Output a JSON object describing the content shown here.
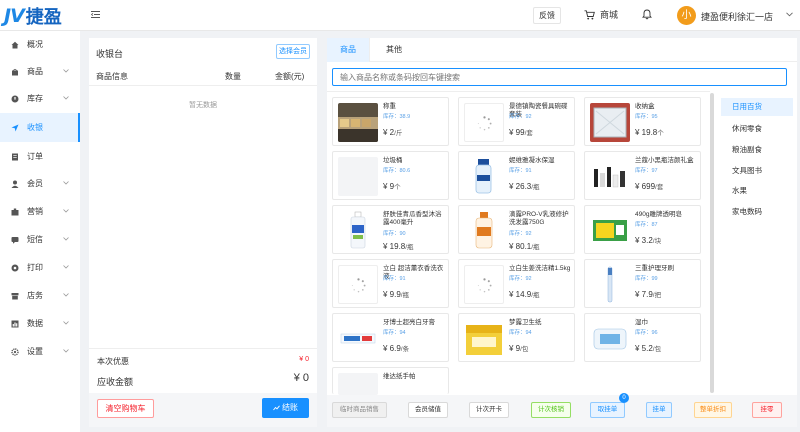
{
  "header": {
    "logo_mark": "JV",
    "logo_text": "捷盈",
    "feedback": "反馈",
    "mall": "商城",
    "avatar_char": "小",
    "store_name": "捷盈便利徐汇一店"
  },
  "sidebar": {
    "items": [
      {
        "label": "概况",
        "icon": "home-icon"
      },
      {
        "label": "商品",
        "icon": "goods-icon"
      },
      {
        "label": "库存",
        "icon": "stock-icon"
      },
      {
        "label": "收银",
        "icon": "cashier-icon"
      },
      {
        "label": "订单",
        "icon": "order-icon"
      },
      {
        "label": "会员",
        "icon": "member-icon"
      },
      {
        "label": "营销",
        "icon": "marketing-icon"
      },
      {
        "label": "短信",
        "icon": "sms-icon"
      },
      {
        "label": "打印",
        "icon": "print-icon"
      },
      {
        "label": "店务",
        "icon": "store-icon"
      },
      {
        "label": "数据",
        "icon": "data-icon"
      },
      {
        "label": "设置",
        "icon": "settings-icon"
      }
    ]
  },
  "cashier": {
    "title": "收银台",
    "choose_member": "选择会员",
    "col_info": "商品信息",
    "col_qty": "数量",
    "col_amount": "金额(元)",
    "empty": "暂无数据",
    "discount_label": "本次优惠",
    "discount_value": "¥ 0",
    "due_label": "应收金额",
    "due_value": "¥ 0",
    "clear": "清空购物车",
    "checkout": "结账"
  },
  "products": {
    "tabs": [
      "商品",
      "其他"
    ],
    "search_placeholder": "输入商品名称或条码按回车键搜索",
    "items": [
      {
        "name": "称重",
        "stock": "库存：38.9",
        "price": "¥ 2",
        "unit": "/斤",
        "thumb": "weigh"
      },
      {
        "name": "景德镇陶瓷餐具碗碟套装",
        "stock": "库存：92",
        "price": "¥ 99",
        "unit": "/套",
        "thumb": "loading"
      },
      {
        "name": "收纳盒",
        "stock": "库存：95",
        "price": "¥ 19.8",
        "unit": "个",
        "thumb": "box"
      },
      {
        "name": "垃圾桶",
        "stock": "库存：80.6",
        "price": "¥ 9",
        "unit": "个",
        "thumb": "placeholder"
      },
      {
        "name": "妮维雅凝水保湿",
        "stock": "库存：91",
        "price": "¥ 26.3",
        "unit": "/瓶",
        "thumb": "lotion"
      },
      {
        "name": "兰蔻小黑瓶洁颜礼盒",
        "stock": "库存：97",
        "price": "¥ 699",
        "unit": "/套",
        "thumb": "cosmetics"
      },
      {
        "name": "舒肤佳青瓜香型沐浴露400毫升",
        "stock": "库存：90",
        "price": "¥ 19.8",
        "unit": "/瓶",
        "thumb": "bodywash"
      },
      {
        "name": "滴露PRO-V乳液修护洗发露750G",
        "stock": "库存：92",
        "price": "¥ 80.1",
        "unit": "/瓶",
        "thumb": "shampoo"
      },
      {
        "name": "490g雕牌透明皂",
        "stock": "库存：87",
        "price": "¥ 3.2",
        "unit": "/块",
        "thumb": "soap"
      },
      {
        "name": "立白 超洁薰衣香洗衣液",
        "stock": "库存：91",
        "price": "¥ 9.9",
        "unit": "/瓶",
        "thumb": "loading"
      },
      {
        "name": "立白生姜洗洁精1.5kg",
        "stock": "库存：92",
        "price": "¥ 14.9",
        "unit": "/瓶",
        "thumb": "loading"
      },
      {
        "name": "三重护理牙刷",
        "stock": "库存：99",
        "price": "¥ 7.9",
        "unit": "/把",
        "thumb": "toothbrush"
      },
      {
        "name": "牙博士超亮白牙膏",
        "stock": "库存：94",
        "price": "¥ 6.9",
        "unit": "/条",
        "thumb": "toothpaste"
      },
      {
        "name": "梦露卫生纸",
        "stock": "库存：94",
        "price": "¥ 9",
        "unit": "/包",
        "thumb": "tissue"
      },
      {
        "name": "湿巾",
        "stock": "库存：96",
        "price": "¥ 5.2",
        "unit": "/包",
        "thumb": "wipes"
      },
      {
        "name": "维达纸手帕",
        "stock": "",
        "price": "",
        "unit": "",
        "thumb": "placeholder"
      }
    ],
    "categories": [
      "日用百货",
      "休闲零食",
      "粮油副食",
      "文具图书",
      "水果",
      "家电数码"
    ],
    "footer": {
      "temp_sale": "临时商品销售",
      "member_recharge": "会员储值",
      "times_card": "计次开卡",
      "times_verify": "计次核销",
      "fetch_order": "取挂单",
      "fetch_badge": "0",
      "hang_order": "挂单",
      "whole_discount": "整单折扣",
      "hang_invoice": "挂零"
    }
  },
  "colors": {
    "primary": "#1890ff",
    "danger": "#f5222d",
    "avatar": "#f29c1b"
  }
}
